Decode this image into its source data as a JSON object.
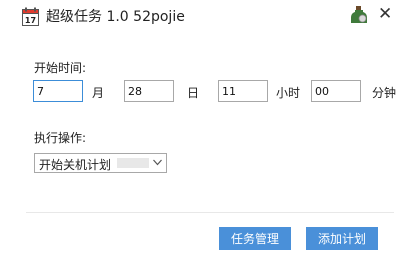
{
  "window": {
    "title": "超级任务 1.0 52pojie"
  },
  "form": {
    "start_time_label": "开始时间:",
    "month_value": "7",
    "month_unit": "月",
    "day_value": "28",
    "day_unit": "日",
    "hour_value": "11",
    "hour_unit": "小时",
    "minute_value": "00",
    "minute_unit": "分钟",
    "action_label": "执行操作:",
    "action_selected": "开始关机计划"
  },
  "buttons": {
    "task_manage": "任务管理",
    "add_plan": "添加计划"
  },
  "colors": {
    "accent": "#4a90d9",
    "active_border": "#3c8dd8"
  }
}
